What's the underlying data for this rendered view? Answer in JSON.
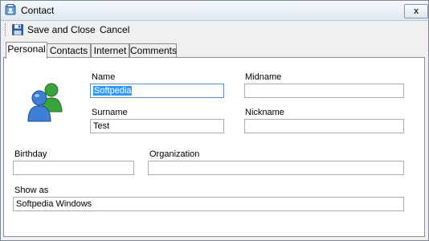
{
  "window": {
    "title": "Contact",
    "close_symbol": "x"
  },
  "toolbar": {
    "save_label": "Save and Close",
    "cancel_label": "Cancel"
  },
  "tabs": [
    {
      "label": "Personal",
      "active": true
    },
    {
      "label": "Contacts",
      "active": false
    },
    {
      "label": "Internet",
      "active": false
    },
    {
      "label": "Comments",
      "active": false
    }
  ],
  "form": {
    "name_label": "Name",
    "name_value": "Softpedia",
    "midname_label": "Midname",
    "midname_value": "",
    "surname_label": "Surname",
    "surname_value": "Test",
    "nickname_label": "Nickname",
    "nickname_value": "",
    "birthday_label": "Birthday",
    "birthday_value": "",
    "organization_label": "Organization",
    "organization_value": "",
    "showas_label": "Show as",
    "showas_value": "Softpedia Windows"
  },
  "icons": {
    "window": "contact-window-icon",
    "save": "floppy-disk-icon",
    "avatar": "users-icon"
  },
  "colors": {
    "selection": "#3399ff",
    "focus_border": "#5b8fd0",
    "user_blue": "#3d7fd4",
    "user_green": "#3aa23a"
  }
}
